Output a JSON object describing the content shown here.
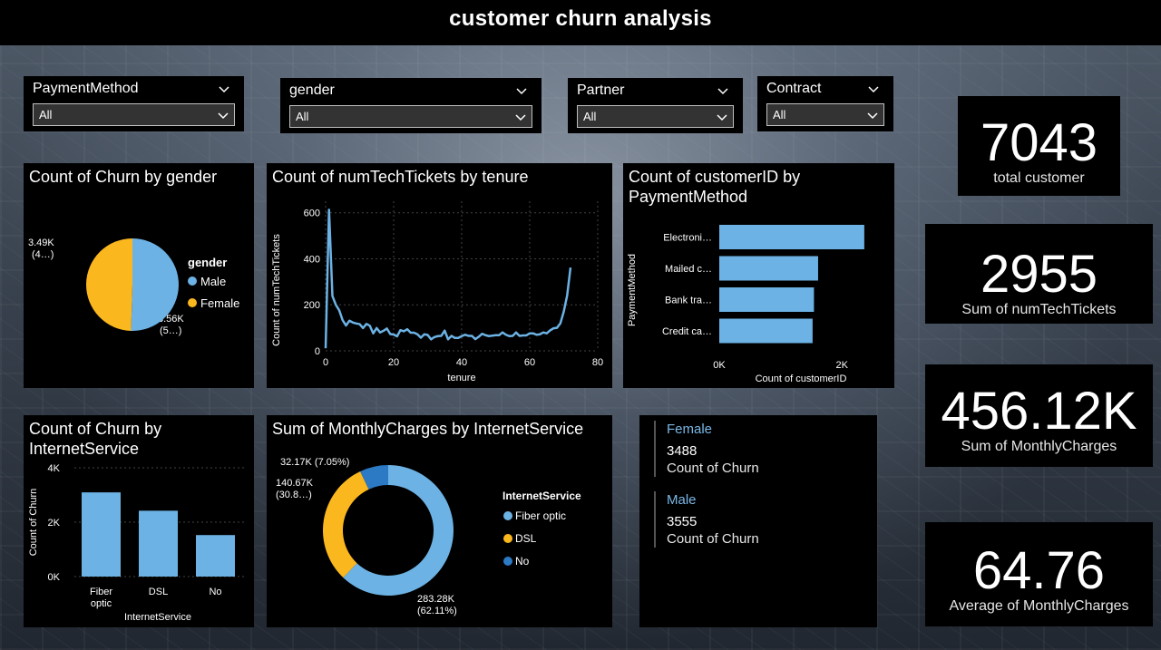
{
  "title": "customer churn analysis",
  "colors": {
    "blue_light": "#6cb2e4",
    "orange": "#fbb71e",
    "blue_dark": "#2c79c4"
  },
  "slicers": [
    {
      "label": "PaymentMethod",
      "value": "All"
    },
    {
      "label": "gender",
      "value": "All"
    },
    {
      "label": "Partner",
      "value": "All"
    },
    {
      "label": "Contract",
      "value": "All"
    }
  ],
  "kpis": [
    {
      "value": "7043",
      "label": "total customer"
    },
    {
      "value": "2955",
      "label": "Sum of numTechTickets"
    },
    {
      "value": "456.12K",
      "label": "Sum of MonthlyCharges"
    },
    {
      "value": "64.76",
      "label": "Average of MonthlyCharges"
    }
  ],
  "multirow": [
    {
      "category": "Female",
      "value": "3488",
      "caption": "Count of Churn"
    },
    {
      "category": "Male",
      "value": "3555",
      "caption": "Count of Churn"
    }
  ],
  "chart_data": [
    {
      "id": "gender_pie",
      "type": "pie",
      "title": "Count of Churn by gender",
      "legend_title": "gender",
      "legend_position": "right",
      "slices": [
        {
          "label": "Male",
          "value": 3555,
          "data_label": "3.56K",
          "data_label_sub": "(5…)",
          "color": "#6cb2e4"
        },
        {
          "label": "Female",
          "value": 3488,
          "data_label": "3.49K",
          "data_label_sub": "(4…)",
          "color": "#fbb71e"
        }
      ]
    },
    {
      "id": "tickets_line",
      "type": "line",
      "title": "Count of numTechTickets by tenure",
      "xlabel": "tenure",
      "ylabel": "Count of numTechTickets",
      "xlim": [
        0,
        80
      ],
      "ylim": [
        0,
        650
      ],
      "xticks": [
        "0",
        "20",
        "40",
        "60",
        "80"
      ],
      "yticks": [
        "0",
        "200",
        "400",
        "600"
      ],
      "grid": true,
      "series": [
        {
          "color": "#6cb2e4",
          "x": [
            0,
            1,
            2,
            3,
            4,
            5,
            6,
            7,
            8,
            9,
            10,
            11,
            12,
            13,
            14,
            15,
            16,
            17,
            18,
            19,
            20,
            21,
            22,
            23,
            24,
            25,
            26,
            27,
            28,
            29,
            30,
            31,
            32,
            33,
            34,
            35,
            36,
            37,
            38,
            39,
            40,
            41,
            42,
            43,
            44,
            45,
            46,
            47,
            48,
            49,
            50,
            51,
            52,
            53,
            54,
            55,
            56,
            57,
            58,
            59,
            60,
            61,
            62,
            63,
            64,
            65,
            66,
            67,
            68,
            69,
            70,
            71,
            72
          ],
          "y": [
            11,
            613,
            238,
            200,
            176,
            133,
            110,
            131,
            123,
            119,
            116,
            99,
            117,
            109,
            76,
            99,
            80,
            87,
            97,
            73,
            71,
            63,
            90,
            85,
            94,
            79,
            79,
            72,
            57,
            72,
            69,
            50,
            60,
            64,
            65,
            88,
            50,
            65,
            56,
            56,
            64,
            70,
            65,
            65,
            51,
            61,
            74,
            68,
            64,
            66,
            68,
            68,
            80,
            70,
            64,
            65,
            80,
            65,
            67,
            67,
            76,
            76,
            70,
            72,
            80,
            76,
            89,
            98,
            100,
            119,
            170,
            240,
            362
          ]
        }
      ]
    },
    {
      "id": "payment_bar",
      "type": "bar",
      "orientation": "horizontal",
      "title": "Count of customerID by PaymentMethod",
      "xlabel": "Count of customerID",
      "ylabel": "PaymentMethod",
      "categories": [
        "Electroni…",
        "Mailed c…",
        "Bank tra…",
        "Credit ca…"
      ],
      "values": [
        2365,
        1612,
        1544,
        1522
      ],
      "xlim": [
        0,
        2500
      ],
      "xticks": [
        "0K",
        "2K"
      ],
      "color": "#6cb2e4"
    },
    {
      "id": "internet_bar",
      "type": "bar",
      "orientation": "vertical",
      "title": "Count of Churn by InternetService",
      "xlabel": "InternetService",
      "ylabel": "Count of Churn",
      "categories": [
        "Fiber optic",
        "DSL",
        "No"
      ],
      "values": [
        3096,
        2421,
        1526
      ],
      "ylim": [
        0,
        4000
      ],
      "yticks": [
        "0K",
        "2K",
        "4K"
      ],
      "grid": true,
      "color": "#6cb2e4"
    },
    {
      "id": "charges_donut",
      "type": "pie",
      "style": "donut",
      "title": "Sum of MonthlyCharges by InternetService",
      "legend_title": "InternetService",
      "legend_position": "right",
      "slices": [
        {
          "label": "Fiber optic",
          "value": 283.28,
          "data_label": "283.28K",
          "data_label_sub": "(62.11%)",
          "color": "#6cb2e4"
        },
        {
          "label": "DSL",
          "value": 140.67,
          "data_label": "140.67K",
          "data_label_sub": "(30.8…)",
          "color": "#fbb71e"
        },
        {
          "label": "No",
          "value": 32.17,
          "data_label": "32.17K (7.05%)",
          "data_label_sub": "",
          "color": "#2c79c4"
        }
      ]
    }
  ]
}
